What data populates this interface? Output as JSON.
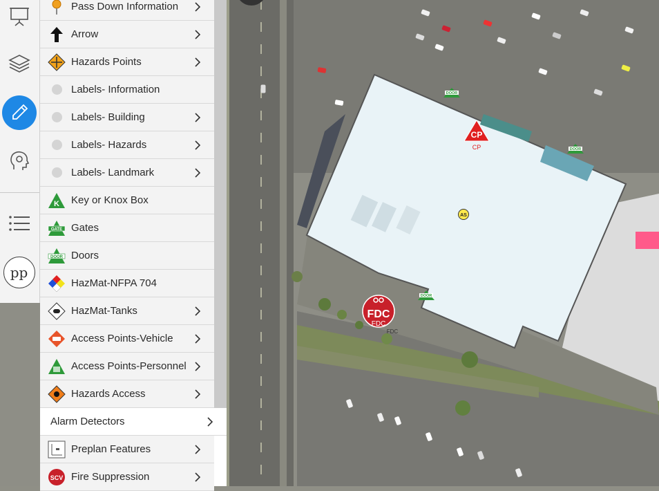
{
  "toolbar": {
    "avatar_initials": "pp"
  },
  "menu": {
    "items": [
      {
        "label": "Pass Down Information",
        "icon": "map-pin-icon",
        "chevron": true
      },
      {
        "label": "Arrow",
        "icon": "arrow-up-icon",
        "chevron": true
      },
      {
        "label": "Hazards Points",
        "icon": "hazard-diamond-icon",
        "chevron": true
      },
      {
        "label": "Labels- Information",
        "icon": "gray-dot-icon",
        "chevron": false
      },
      {
        "label": "Labels- Building",
        "icon": "gray-dot-icon",
        "chevron": true
      },
      {
        "label": "Labels- Hazards",
        "icon": "gray-dot-icon",
        "chevron": true
      },
      {
        "label": "Labels- Landmark",
        "icon": "gray-dot-icon",
        "chevron": true
      },
      {
        "label": "Key or Knox Box",
        "icon": "key-box-icon",
        "chevron": false
      },
      {
        "label": "Gates",
        "icon": "gate-icon",
        "chevron": false
      },
      {
        "label": "Doors",
        "icon": "door-icon",
        "chevron": false
      },
      {
        "label": "HazMat-NFPA 704",
        "icon": "nfpa-diamond-icon",
        "chevron": false
      },
      {
        "label": "HazMat-Tanks",
        "icon": "tank-icon",
        "chevron": true
      },
      {
        "label": "Access Points-Vehicle",
        "icon": "vehicle-access-icon",
        "chevron": true
      },
      {
        "label": "Access Points-Personnel",
        "icon": "personnel-access-icon",
        "chevron": true
      },
      {
        "label": "Hazards Access",
        "icon": "hazard-access-icon",
        "chevron": true
      },
      {
        "label": "Alarm Detectors",
        "icon": "",
        "chevron": true
      },
      {
        "label": "Preplan Features",
        "icon": "preplan-feature-icon",
        "chevron": true
      },
      {
        "label": "Fire Suppression",
        "icon": "fire-suppression-icon",
        "chevron": true
      }
    ]
  },
  "map": {
    "markers": {
      "door_label": "DOOR",
      "cp_label": "CP",
      "as_label": "AS",
      "fdc_label": "FDC",
      "fdc_caption": "FDC",
      "fdc_subcaption": "FDC"
    }
  },
  "colors": {
    "accent": "#1e88e5",
    "building": "#e9f3f7",
    "hazard_red": "#e02020",
    "access_green": "#2e9a3a"
  }
}
